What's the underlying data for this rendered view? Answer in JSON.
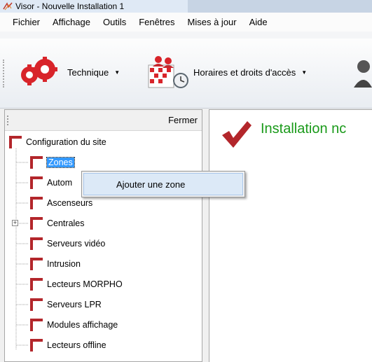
{
  "window": {
    "title": "Visor - Nouvelle Installation 1"
  },
  "menu": {
    "items": [
      "Fichier",
      "Affichage",
      "Outils",
      "Fenêtres",
      "Mises à jour",
      "Aide"
    ]
  },
  "toolbar": {
    "technique_label": "Technique",
    "horaires_label": "Horaires et droits d'accès"
  },
  "left_pane": {
    "close_label": "Fermer",
    "tree": {
      "root": "Configuration du site",
      "children": [
        "Zones",
        "Autom",
        "Ascenseurs",
        "Centrales",
        "Serveurs vidéo",
        "Intrusion",
        "Lecteurs MORPHO",
        "Serveurs LPR",
        "Modules affichage",
        "Lecteurs offline"
      ]
    }
  },
  "right_pane": {
    "message": "Installation nc"
  },
  "context_menu": {
    "item": "Ajouter une zone"
  },
  "colors": {
    "accent_red": "#b3262b",
    "success_green": "#1a9a1a",
    "selection_blue": "#3399ff"
  }
}
